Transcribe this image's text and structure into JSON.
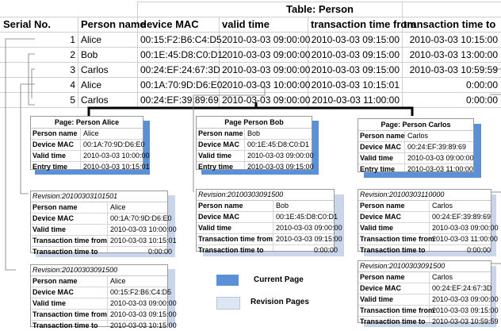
{
  "table": {
    "title": "Table: Person",
    "headers": [
      "Serial No.",
      "Person name",
      "device MAC",
      "valid time",
      "transaction time from",
      "transaction time to"
    ],
    "rows": [
      {
        "serial": "1",
        "name": "Alice",
        "mac": "00:15:F2:B6:C4:D5",
        "valid": "2010-03-03  09:00:00",
        "from": "2010-03-03  09:15:00",
        "to": "2010-03-03  10:15:00"
      },
      {
        "serial": "2",
        "name": "Bob",
        "mac": "00:1E:45:D8:C0:D1",
        "valid": "2010-03-03  09:00:00",
        "from": "2010-03-03  09:15:00",
        "to": "2010-03-03  13:00:00"
      },
      {
        "serial": "3",
        "name": "Carlos",
        "mac": "00:24:EF:24:67:3D",
        "valid": "2010-03-03  09:00:00",
        "from": "2010-03-03  09:15:00",
        "to": "2010-03-03  10:59:59"
      },
      {
        "serial": "4",
        "name": "Alice",
        "mac": "00:1A:70:9D:D6:E0",
        "valid": "2010-03-03  10:00:00",
        "from": "2010-03-03  10:15:01",
        "to": "0:00:00"
      },
      {
        "serial": "5",
        "name": "Carlos",
        "mac": "00:24:EF:39:89:69",
        "valid": "2010-03-03  09:00:00",
        "from": "2010-03-03  11:00:00",
        "to": "0:00:00"
      }
    ]
  },
  "pages": [
    {
      "title": "Page: Person Alice",
      "rows": [
        {
          "label": "Person name",
          "value": "Alice"
        },
        {
          "label": "Device MAC",
          "value": "00:1A:70:9D:D6:E0"
        },
        {
          "label": "Valid time",
          "value": "2010-03-03  10:00:00"
        },
        {
          "label": "Entry time",
          "value": "2010-03-03  10:15:01"
        }
      ]
    },
    {
      "title": "Page Person Bob",
      "rows": [
        {
          "label": "Person name",
          "value": "Bob"
        },
        {
          "label": "Device MAC",
          "value": "00:1E:45:D8:C0:D1"
        },
        {
          "label": "Valid time",
          "value": "2010-03-03  09:00:00"
        },
        {
          "label": "Entry time",
          "value": "2010-03-03  09:15:00"
        }
      ]
    },
    {
      "title": "Page: Person Carlos",
      "rows": [
        {
          "label": "Person name",
          "value": "Carlos"
        },
        {
          "label": "Device MAC",
          "value": "00:24:EF:39:89:69"
        },
        {
          "label": "Valid time",
          "value": "2010-03-03  09:00:00"
        },
        {
          "label": "Entry time",
          "value": "2010-03-03  11:00:00"
        }
      ]
    }
  ],
  "revisions": [
    {
      "title": "Revision:20100303101501",
      "rows": [
        {
          "label": "Person name",
          "value": "Alice"
        },
        {
          "label": "Device MAC",
          "value": "00:1A:70:9D:D6:E0"
        },
        {
          "label": "Valid time",
          "value": "2010-03-03  10:00:00"
        },
        {
          "label": "Transaction time from",
          "value": "2010-03-03  10:15:01"
        },
        {
          "label": "Transaction time to",
          "value": "0:00:00"
        }
      ]
    },
    {
      "title": "Revision:20100303091500",
      "rows": [
        {
          "label": "Person name",
          "value": "Bob"
        },
        {
          "label": "Device MAC",
          "value": "00:1E:45:D8:C0:D1"
        },
        {
          "label": "Valid time",
          "value": "2010-03-03  09:00:00"
        },
        {
          "label": "Transaction time from",
          "value": "2010-03-03  09:15:00"
        },
        {
          "label": "Transaction time to",
          "value": "0:00:00"
        }
      ]
    },
    {
      "title": "Revision:20100303110000",
      "rows": [
        {
          "label": "Person name",
          "value": "Carlos"
        },
        {
          "label": "Device MAC",
          "value": "00:24:EF:39:89:69"
        },
        {
          "label": "Valid time",
          "value": "2010-03-03  09:00:00"
        },
        {
          "label": "Transaction time from",
          "value": "2010-03-03  11:00:00"
        },
        {
          "label": "Transaction time to",
          "value": "0:00:00"
        }
      ]
    },
    {
      "title": "Revision:20100303091500",
      "rows": [
        {
          "label": "Person name",
          "value": "Alice"
        },
        {
          "label": "Device MAC",
          "value": "00:15:F2:B6:C4:D5"
        },
        {
          "label": "Valid time",
          "value": "2010-03-03  09:00:00"
        },
        {
          "label": "Transaction time from",
          "value": "2010-03-03  09:15:00"
        },
        {
          "label": "Transaction time to",
          "value": "2010-03-03  10:15:00"
        }
      ]
    },
    {
      "title": "Revision:20100303091500",
      "rows": [
        {
          "label": "Person name",
          "value": "Carlos"
        },
        {
          "label": "Device MAC",
          "value": "00:24:EF:24:67:3D"
        },
        {
          "label": "Valid time",
          "value": "2010-03-03  09:00:00"
        },
        {
          "label": "Transaction time from",
          "value": "2010-03-03  09:15:00"
        },
        {
          "label": "Transaction time to",
          "value": "2010-03-03  10:59:59"
        }
      ]
    }
  ],
  "legend": {
    "current_label": "Current Page",
    "revision_label": "Revision Pages",
    "current_color": "#5b8fd6",
    "revision_color": "#dde6f3"
  }
}
